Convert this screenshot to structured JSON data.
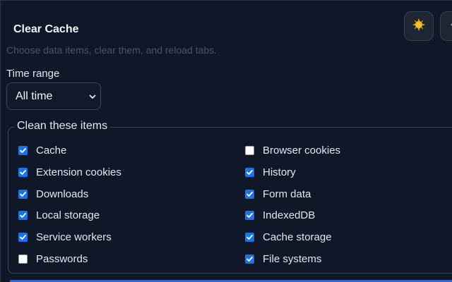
{
  "header": {
    "title": "Clear Cache",
    "subtitle": "Choose data items, clear them, and reload tabs.",
    "theme_icon": "sun-icon"
  },
  "time_range": {
    "label": "Time range",
    "selected": "All time"
  },
  "items_section": {
    "legend": "Clean these items",
    "left": [
      {
        "label": "Cache",
        "checked": true
      },
      {
        "label": "Extension cookies",
        "checked": true
      },
      {
        "label": "Downloads",
        "checked": true
      },
      {
        "label": "Local storage",
        "checked": true
      },
      {
        "label": "Service workers",
        "checked": true
      },
      {
        "label": "Passwords",
        "checked": false
      }
    ],
    "right": [
      {
        "label": "Browser cookies",
        "checked": false
      },
      {
        "label": "History",
        "checked": true
      },
      {
        "label": "Form data",
        "checked": true
      },
      {
        "label": "IndexedDB",
        "checked": true
      },
      {
        "label": "Cache storage",
        "checked": true
      },
      {
        "label": "File systems",
        "checked": true
      }
    ]
  },
  "colors": {
    "background": "#0f1729",
    "checkbox_checked": "#1a73e8",
    "sun": "#f5b81c"
  }
}
